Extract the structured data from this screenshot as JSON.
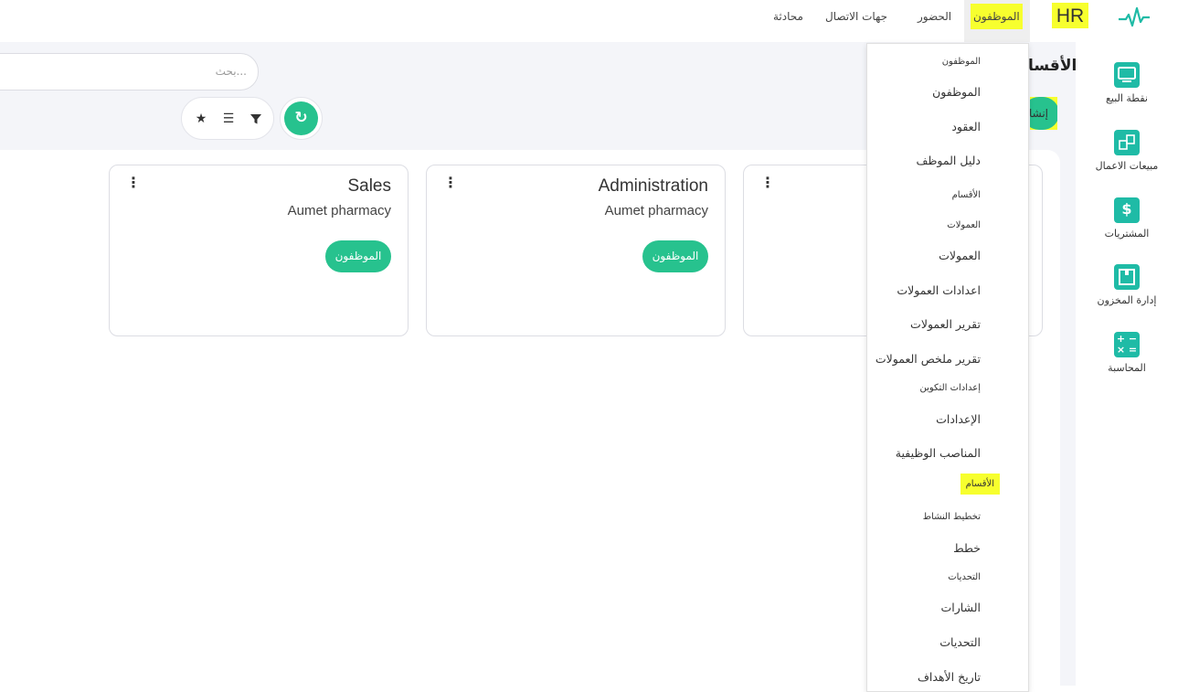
{
  "app": {
    "title": "HR"
  },
  "topnav": {
    "items": [
      "الموظفون",
      "الحضور",
      "جهات الاتصال",
      "محادثة"
    ]
  },
  "sidebar": {
    "items": [
      {
        "label": "نقطة البيع",
        "icon": "monitor-icon"
      },
      {
        "label": "مبيعات الاعمال",
        "icon": "handshake-icon"
      },
      {
        "label": "المشتريات",
        "icon": "dollar-icon"
      },
      {
        "label": "إدارة المخزون",
        "icon": "box-icon"
      },
      {
        "label": "المحاسبة",
        "icon": "calculator-icon"
      }
    ]
  },
  "control_panel": {
    "title": "الأقسا",
    "create_label": "إنشا",
    "search_placeholder": "بحث..."
  },
  "cards": [
    {
      "title": "Sales",
      "company": "Aumet pharmacy",
      "button": "الموظفون"
    },
    {
      "title": "Administration",
      "company": "Aumet pharmacy",
      "button": "الموظفون"
    }
  ],
  "dropdown": {
    "items": [
      {
        "label": "الموظفون",
        "type": "header"
      },
      {
        "label": "الموظفون",
        "type": "link"
      },
      {
        "label": "العقود",
        "type": "link"
      },
      {
        "label": "دليل الموظف",
        "type": "link"
      },
      {
        "label": "الأقسام",
        "type": "header"
      },
      {
        "label": "العمولات",
        "type": "header"
      },
      {
        "label": "العمولات",
        "type": "link"
      },
      {
        "label": "اعدادات العمولات",
        "type": "link"
      },
      {
        "label": "تقرير العمولات",
        "type": "link"
      },
      {
        "label": "تقرير ملخص العمولات",
        "type": "link"
      },
      {
        "label": "إعدادات التكوين",
        "type": "header"
      },
      {
        "label": "الإعدادات",
        "type": "link"
      },
      {
        "label": "المناصب الوظيفية",
        "type": "link"
      },
      {
        "label": "الأقسام",
        "type": "header"
      },
      {
        "label": "تخطيط النشاط",
        "type": "header"
      },
      {
        "label": "خطط",
        "type": "link"
      },
      {
        "label": "التحديات",
        "type": "header"
      },
      {
        "label": "الشارات",
        "type": "link"
      },
      {
        "label": "التحديات",
        "type": "link"
      },
      {
        "label": "تاريخ الأهداف",
        "type": "link"
      }
    ]
  },
  "colors": {
    "accent": "#27c28e",
    "highlight": "#f7ff2e",
    "icon": "#1fbba6"
  }
}
